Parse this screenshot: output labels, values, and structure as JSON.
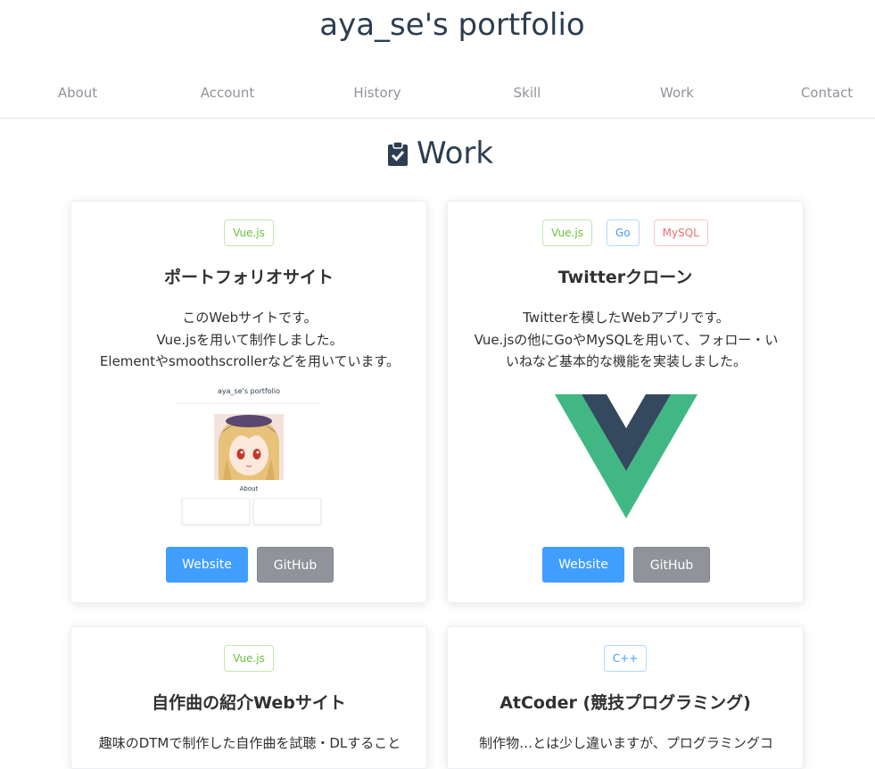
{
  "site": {
    "title": "aya_se's portfolio"
  },
  "nav": [
    "About",
    "Account",
    "History",
    "Skill",
    "Work",
    "Contact"
  ],
  "section": {
    "title": "Work",
    "icon": "clipboard-check-icon"
  },
  "cards": [
    {
      "tags": [
        "Vue.js"
      ],
      "title": "ポートフォリオサイト",
      "description": "このWebサイトです。\nVue.jsを用いて制作しました。\nElementやsmoothscrollerなどを用いています。",
      "image": "portfolio-screenshot",
      "buttons": {
        "website": "Website",
        "github": "GitHub"
      }
    },
    {
      "tags": [
        "Vue.js",
        "Go",
        "MySQL"
      ],
      "title": "Twitterクローン",
      "description": "Twitterを模したWebアプリです。\nVue.jsの他にGoやMySQLを用いて、フォロー・い\nいねなど基本的な機能を実装しました。",
      "image": "vue-logo",
      "buttons": {
        "website": "Website",
        "github": "GitHub"
      }
    },
    {
      "tags": [
        "Vue.js"
      ],
      "title": "自作曲の紹介Webサイト",
      "description": "趣味のDTMで制作した自作曲を試聴・DLすること"
    },
    {
      "tags": [
        "C++"
      ],
      "title": "AtCoder (競技プログラミング)",
      "description": "制作物…とは少し違いますが、プログラミングコ"
    }
  ],
  "thumbnail": {
    "title": "aya_se's portfolio",
    "about": "About"
  },
  "colors": {
    "primary": "#409eff",
    "gray_button": "#909399",
    "tag_green": "#67c23a",
    "tag_blue": "#409eff",
    "tag_red": "#f56c6c",
    "vue_green": "#41b883",
    "vue_dark": "#34495e"
  }
}
